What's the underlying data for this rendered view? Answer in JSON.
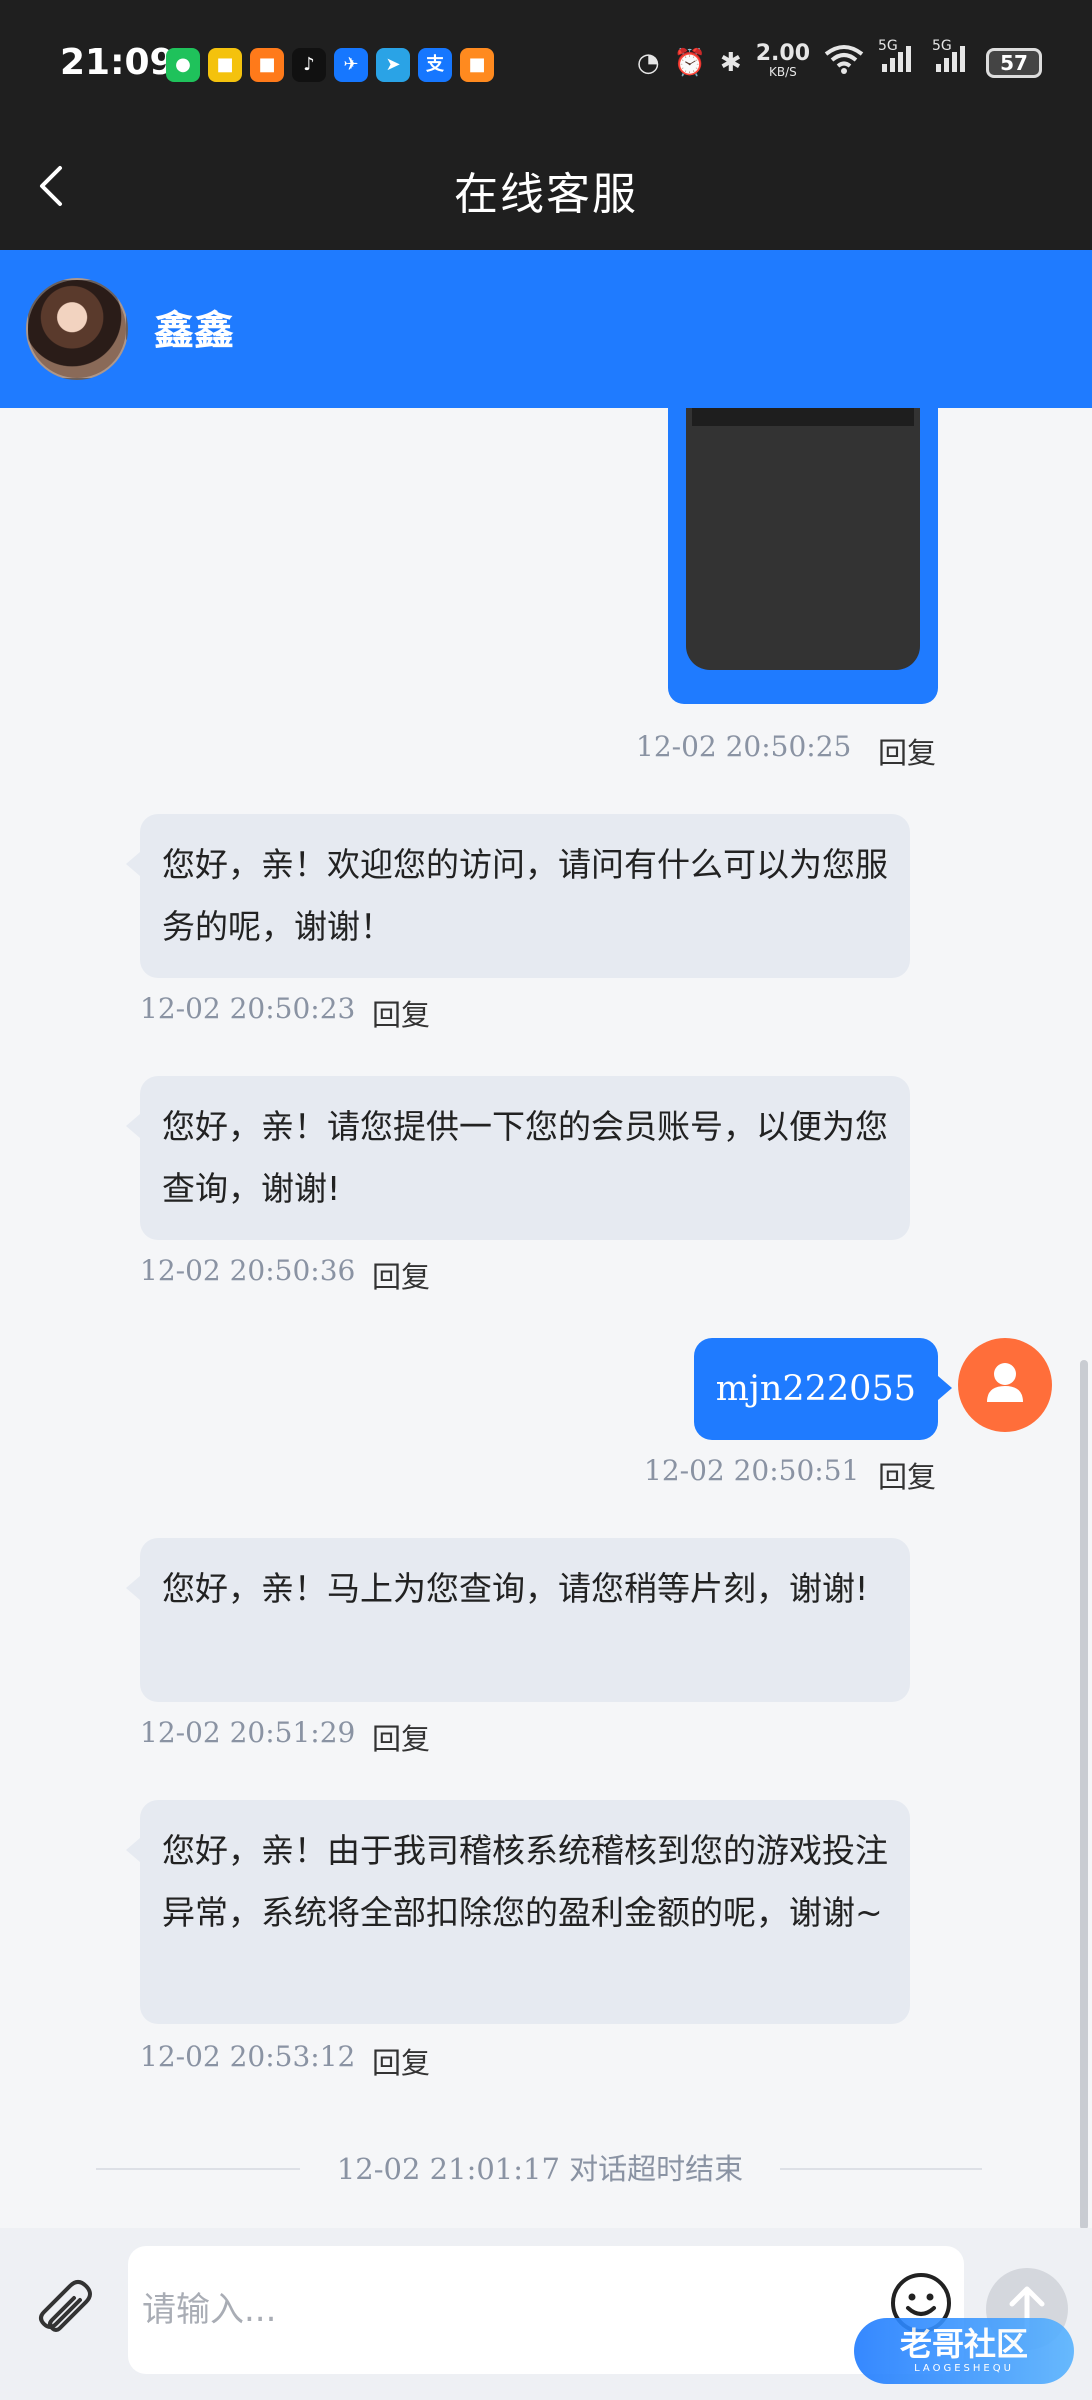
{
  "status_bar": {
    "time": "21:09",
    "speed_value": "2.00",
    "speed_unit": "KB/S",
    "sim1": "5G",
    "sim2": "5G",
    "battery": "57",
    "app_icons": [
      {
        "name": "wechat-icon",
        "glyph": "●",
        "color": "#1fc25b"
      },
      {
        "name": "app-icon-yellow",
        "glyph": "■",
        "color": "#f4c20d"
      },
      {
        "name": "app-icon-orange",
        "glyph": "■",
        "color": "#ff7a1a"
      },
      {
        "name": "tiktok-icon",
        "glyph": "♪",
        "color": "#111111"
      },
      {
        "name": "app-icon-blue",
        "glyph": "✈",
        "color": "#1677ff"
      },
      {
        "name": "telegram-icon",
        "glyph": "➤",
        "color": "#2aa3e6"
      },
      {
        "name": "alipay-icon",
        "glyph": "支",
        "color": "#1677ff"
      },
      {
        "name": "app-icon-orange-2",
        "glyph": "■",
        "color": "#ff8a1f"
      }
    ]
  },
  "header": {
    "title": "在线客服"
  },
  "agent": {
    "name": "鑫鑫"
  },
  "messages": {
    "img_msg": {
      "time": "12-02 20:50:25",
      "reply": "回复"
    },
    "m1": {
      "text": "您好，亲！欢迎您的访问，请问有什么可以为您服务的呢，谢谢！",
      "time": "12-02 20:50:23",
      "reply": "回复"
    },
    "m2": {
      "text": "您好，亲！请您提供一下您的会员账号，以便为您查询，谢谢!",
      "time": "12-02 20:50:36",
      "reply": "回复"
    },
    "m3": {
      "text": "mjn222055",
      "time": "12-02 20:50:51",
      "reply": "回复"
    },
    "m4": {
      "text": "您好，亲！马上为您查询，请您稍等片刻，谢谢!",
      "time": "12-02 20:51:29",
      "reply": "回复"
    },
    "m5": {
      "text": "您好，亲！由于我司稽核系统稽核到您的游戏投注异常，系统将全部扣除您的盈利金额的呢，谢谢~",
      "time": "12-02 20:53:12",
      "reply": "回复"
    }
  },
  "session_end": {
    "time": "12-02 21:01:17",
    "text": "对话超时结束"
  },
  "input": {
    "placeholder": "请输入..."
  },
  "watermark": {
    "title": "老哥社区",
    "sub": "LAOGESHEQU"
  },
  "colors": {
    "brand_blue": "#1f7bff",
    "agent_bubble": "#e6eaf1",
    "user_avatar": "#ff6e3a",
    "dark_bar": "#1f1f1f"
  }
}
